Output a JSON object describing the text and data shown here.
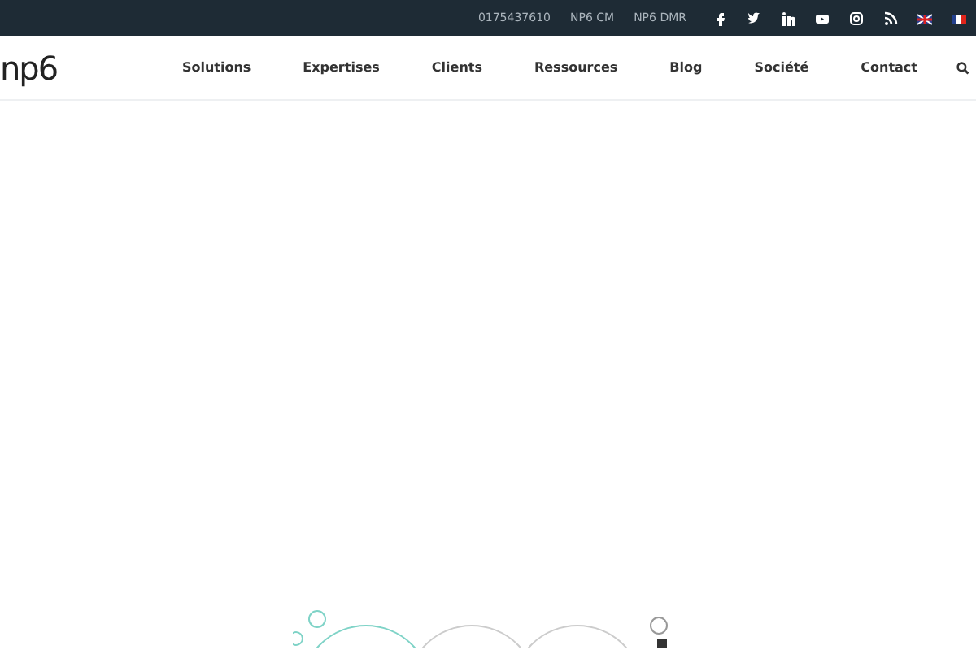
{
  "topbar": {
    "links": [
      "0175437610",
      "NP6 CM",
      "NP6 DMR"
    ]
  },
  "header": {
    "logo": "np6",
    "menu": [
      "Solutions",
      "Expertises",
      "Clients",
      "Ressources",
      "Blog",
      "Société",
      "Contact"
    ]
  }
}
